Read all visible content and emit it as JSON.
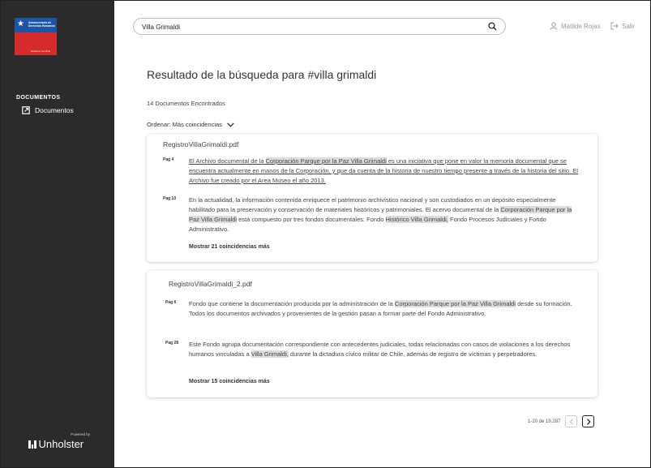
{
  "sidebar": {
    "logo": {
      "org_name": "Subsecretaría de Derechos Humanos",
      "gov": "Gobierno de Chile"
    },
    "section_title": "DOCUMENTOS",
    "items": [
      {
        "label": "Documentos",
        "icon": "external-document-icon"
      }
    ],
    "powered_by": "Powered by",
    "brand": "Unholster"
  },
  "header": {
    "search": {
      "value": "Villa Grimaldi",
      "placeholder": ""
    },
    "user_name": "Matilde Rojas",
    "logout_label": "Salir"
  },
  "main": {
    "title": "Resultado de la búsqueda para #villa grimaldi",
    "count": "14 Documentos Encontrados",
    "sort_label": "Ordenar: Más coincidencias"
  },
  "results": [
    {
      "filename": "RegistroVillaGrimaldi.pdf",
      "hits": [
        {
          "page": "Pag 4",
          "segments": [
            {
              "t": "El Archivo documental de la ",
              "c": "ul"
            },
            {
              "t": "Corporación Parque por la Paz Villa Grimaldi",
              "c": "ul hl"
            },
            {
              "t": " es una iniciativa que pone en valor la memoria documental que se encuentra actualmente en manos de la Corporación, y que da cuenta de la historia de nuestro tiempo presente a través de la historia del sitio. El Archivo fue creado por el Area Museo el año 2013.",
              "c": "ul"
            }
          ]
        },
        {
          "page": "Pag 10",
          "segments": [
            {
              "t": "En la actualidad, la información contenida enriquece el patrimonio archivístico nacional y son custodiados en un depósito especialmente habilitado para la preservación y conservación de materiales históricos y patrimoniales. El acervo documental de la ",
              "c": ""
            },
            {
              "t": "Corporación Parque por la Paz Villa Grimaldi",
              "c": "hl"
            },
            {
              "t": " está compuesto por tres fondos documentales: Fondo ",
              "c": ""
            },
            {
              "t": "Histórico Villa Grimaldi,",
              "c": "hl"
            },
            {
              "t": " Fondo Procesos Judiciales y Fondo Administrativo.",
              "c": ""
            }
          ]
        }
      ],
      "more_label": "Mostrar 21 coincidencias más"
    },
    {
      "filename": "RegistroVillaGrimaldi_2.pdf",
      "hits": [
        {
          "page": "Pag 6",
          "segments": [
            {
              "t": "Fondo que contiene la documentación producida por la administración de la ",
              "c": ""
            },
            {
              "t": "Corporación Parque por la Paz Villa Grimaldi",
              "c": "hl"
            },
            {
              "t": " desde su formación. Todos los documentos archivados y provenientes de la gestión pasan a formar parte del Fondo Administrativo.",
              "c": ""
            }
          ]
        },
        {
          "page": "Pag 28",
          "segments": [
            {
              "t": "Este Fondo agrupa documentación correspondiente con antecedentes judiciales, todas relacionadas con casos de violaciones a los derechos humanos vinculadas a ",
              "c": ""
            },
            {
              "t": "Villa Grimaldi,",
              "c": "hl"
            },
            {
              "t": " durante la dictadura cívico militar de Chile, además de registro de víctimas y perpetradores.",
              "c": ""
            }
          ]
        }
      ],
      "more_label": "Mostrar 15 coincidencias más"
    }
  ],
  "pagination": {
    "range_text": "1-20 de 19.287"
  }
}
